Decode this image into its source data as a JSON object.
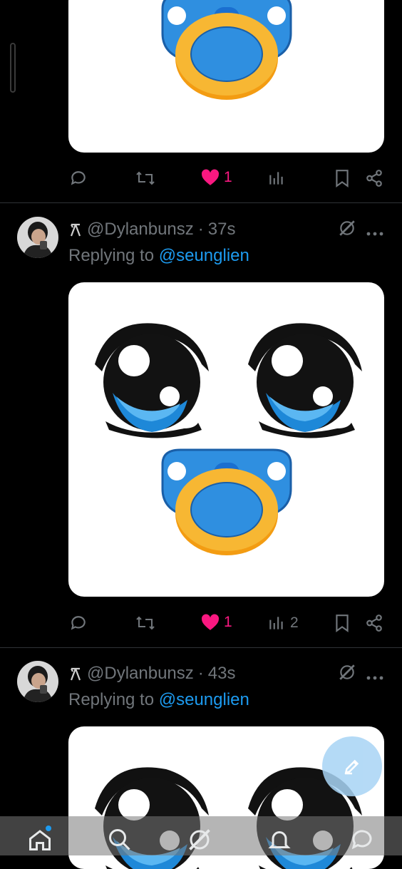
{
  "tweets": [
    {
      "likes": "1",
      "views": ""
    },
    {
      "username": "@Dylanbunsz",
      "time": "37s",
      "replying_prefix": "Replying to",
      "replying_to": "@seunglien",
      "likes": "1",
      "views": "2"
    },
    {
      "username": "@Dylanbunsz",
      "time": "43s",
      "replying_prefix": "Replying to",
      "replying_to": "@seunglien"
    }
  ],
  "separator": "·",
  "colors": {
    "background": "#000000",
    "muted_text": "#71767b",
    "link": "#1d9bf0",
    "like_active": "#f91880",
    "pacifier_blue": "#2f8fe0",
    "pacifier_ring": "#f7a823",
    "fab": "#a8d4f5"
  },
  "icons": [
    "reply-icon",
    "retweet-icon",
    "heart-icon",
    "views-icon",
    "bookmark-icon",
    "share-icon",
    "grok-icon",
    "more-icon",
    "compose-icon",
    "home-icon",
    "search-icon",
    "notifications-icon",
    "messages-icon"
  ]
}
